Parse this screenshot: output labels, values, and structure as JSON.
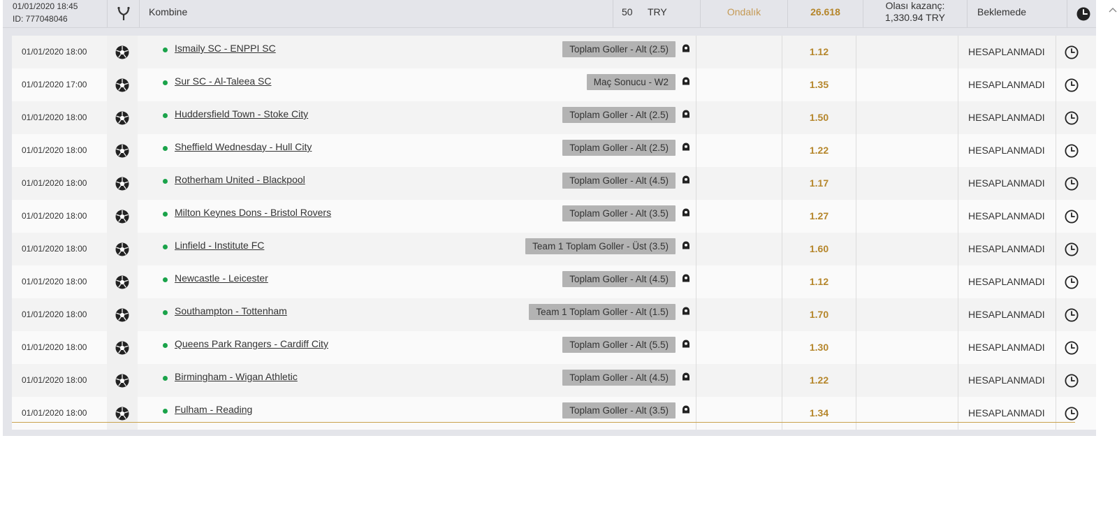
{
  "bet": {
    "datetime": "01/01/2020 18:45",
    "id": "ID: 777048046",
    "type_icon": "combo-branch-icon",
    "type": "Kombine",
    "stake": "50",
    "currency": "TRY",
    "odds_format": "Ondalık",
    "total_odds": "26.618",
    "potential_win_label": "Olası kazanç:",
    "potential_win_value": "1,330.94 TRY",
    "status": "Beklemede",
    "status_icon": "clock-filled-icon"
  },
  "colors": {
    "accent_odds": "#b5862b",
    "format_text": "#c59a55",
    "live_dot": "#1aa34a",
    "market_badge_bg": "#b3b3b3"
  },
  "selections": [
    {
      "datetime": "01/01/2020 18:00",
      "match": "Ismaily SC - ENPPI SC",
      "market": "Toplam Goller - Alt (2.5)",
      "odds": "1.12",
      "status": "HESAPLANMADI"
    },
    {
      "datetime": "01/01/2020 17:00",
      "match": "Sur SC - Al-Taleea SC",
      "market": "Maç Sonucu - W2",
      "odds": "1.35",
      "status": "HESAPLANMADI"
    },
    {
      "datetime": "01/01/2020 18:00",
      "match": "Huddersfield Town - Stoke City",
      "market": "Toplam Goller - Alt (2.5)",
      "odds": "1.50",
      "status": "HESAPLANMADI"
    },
    {
      "datetime": "01/01/2020 18:00",
      "match": "Sheffield Wednesday - Hull City",
      "market": "Toplam Goller - Alt (2.5)",
      "odds": "1.22",
      "status": "HESAPLANMADI"
    },
    {
      "datetime": "01/01/2020 18:00",
      "match": "Rotherham United - Blackpool",
      "market": "Toplam Goller - Alt (4.5)",
      "odds": "1.17",
      "status": "HESAPLANMADI"
    },
    {
      "datetime": "01/01/2020 18:00",
      "match": "Milton Keynes Dons - Bristol Rovers",
      "market": "Toplam Goller - Alt (3.5)",
      "odds": "1.27",
      "status": "HESAPLANMADI"
    },
    {
      "datetime": "01/01/2020 18:00",
      "match": "Linfield - Institute FC",
      "market": "Team 1 Toplam Goller - Üst (3.5)",
      "odds": "1.60",
      "status": "HESAPLANMADI"
    },
    {
      "datetime": "01/01/2020 18:00",
      "match": "Newcastle - Leicester",
      "market": "Toplam Goller - Alt (4.5)",
      "odds": "1.12",
      "status": "HESAPLANMADI"
    },
    {
      "datetime": "01/01/2020 18:00",
      "match": "Southampton - Tottenham",
      "market": "Team 1 Toplam Goller - Alt (1.5)",
      "odds": "1.70",
      "status": "HESAPLANMADI"
    },
    {
      "datetime": "01/01/2020 18:00",
      "match": "Queens Park Rangers - Cardiff City",
      "market": "Toplam Goller - Alt (5.5)",
      "odds": "1.30",
      "status": "HESAPLANMADI"
    },
    {
      "datetime": "01/01/2020 18:00",
      "match": "Birmingham - Wigan Athletic",
      "market": "Toplam Goller - Alt (4.5)",
      "odds": "1.22",
      "status": "HESAPLANMADI"
    },
    {
      "datetime": "01/01/2020 18:00",
      "match": "Fulham - Reading",
      "market": "Toplam Goller - Alt (3.5)",
      "odds": "1.34",
      "status": "HESAPLANMADI"
    }
  ],
  "row_icons": {
    "sport": "soccer-ball-icon",
    "pin": "player-pin-icon",
    "status": "clock-outline-icon"
  }
}
